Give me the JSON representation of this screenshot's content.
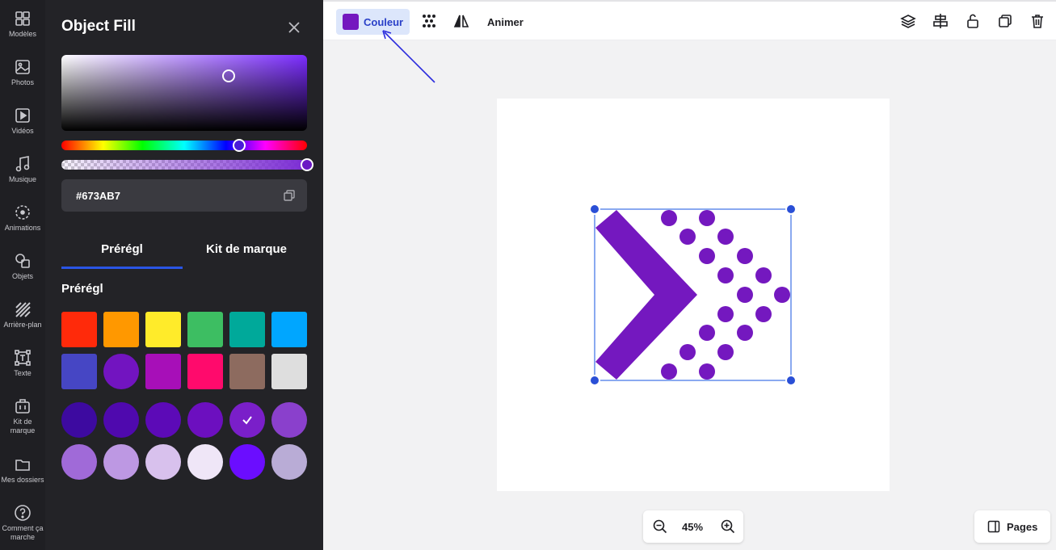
{
  "rail": [
    {
      "label": "Modèles",
      "icon": "templates-icon"
    },
    {
      "label": "Photos",
      "icon": "photo-icon"
    },
    {
      "label": "Vidéos",
      "icon": "video-icon"
    },
    {
      "label": "Musique",
      "icon": "music-icon"
    },
    {
      "label": "Animations",
      "icon": "animation-icon"
    },
    {
      "label": "Objets",
      "icon": "shapes-icon"
    },
    {
      "label": "Arrière-plan",
      "icon": "background-icon"
    },
    {
      "label": "Texte",
      "icon": "text-icon"
    },
    {
      "label": "Kit de marque",
      "icon": "brand-kit-icon"
    },
    {
      "label": "Mes dossiers",
      "icon": "folder-icon"
    },
    {
      "label": "Comment ça marche",
      "icon": "help-icon"
    }
  ],
  "panel": {
    "title": "Object Fill",
    "hex": "#673AB7",
    "tabs": [
      "Prérégl",
      "Kit de marque"
    ],
    "active_tab": "Prérégl",
    "section_label": "Prérégl",
    "square_swatches": [
      "#ff2a0a",
      "#ff9800",
      "#ffeb2a",
      "#3dbe62",
      "#00a99a",
      "#00a6ff",
      "#4646c4",
      "#7214c0",
      "#a70fb8",
      "#ff0a6c",
      "#8d6b5f",
      "#dedede"
    ],
    "round_swatch_index": 7,
    "shade_swatches": [
      "#3d0aa0",
      "#4f09ae",
      "#5c0ab7",
      "#6c0fbf",
      "#7a1fc9",
      "#8a40cc",
      "#a06ad8",
      "#bd98e3",
      "#d8c1ed",
      "#efe6f7",
      "#6b0dff",
      "#b9acd6"
    ],
    "selected_shade_index": 4
  },
  "toolbar": {
    "color_label": "Couleur",
    "animate_label": "Animer",
    "selected_color": "#7418bf"
  },
  "zoom": {
    "value": "45%"
  },
  "pages": {
    "label": "Pages"
  },
  "accent": "#2a55e5"
}
